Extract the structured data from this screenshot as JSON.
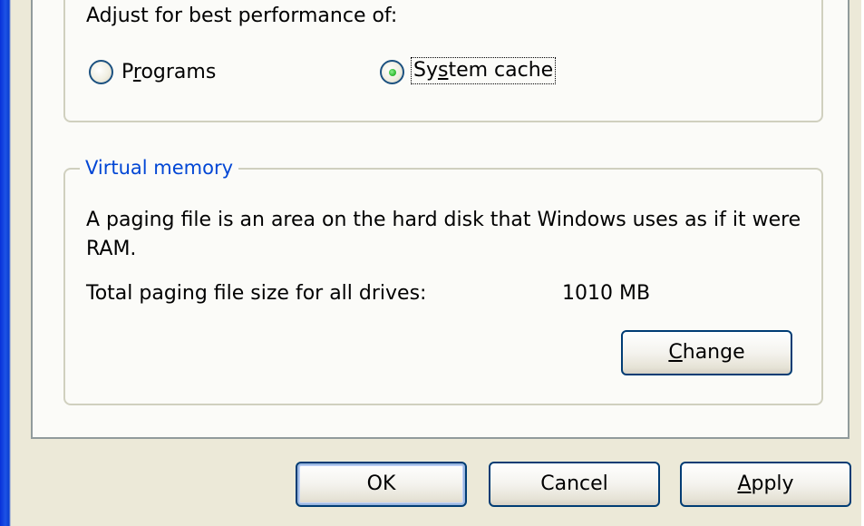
{
  "performance": {
    "heading": "Adjust for best performance of:",
    "options": [
      {
        "label_pre": "P",
        "label_key": "r",
        "label_post": "ograms",
        "selected": false
      },
      {
        "label_pre": "Sy",
        "label_key": "s",
        "label_post": "tem cache",
        "selected": true
      }
    ]
  },
  "virtual_memory": {
    "legend": "Virtual memory",
    "description": "A paging file is an area on the hard disk that Windows uses as if it were RAM.",
    "paging_label": "Total paging file size for all drives:",
    "paging_value": "1010 MB",
    "change_button": {
      "label_key": "C",
      "label_post": "hange"
    }
  },
  "dialog_buttons": {
    "ok": "OK",
    "cancel": "Cancel",
    "apply": {
      "label_key": "A",
      "label_post": "pply"
    }
  },
  "colors": {
    "legend_text": "#0046d5",
    "panel_background": "#fbfbf8",
    "dialog_background": "#ece9d8",
    "button_border": "#003c74",
    "radio_dot": "#3ac13a"
  }
}
